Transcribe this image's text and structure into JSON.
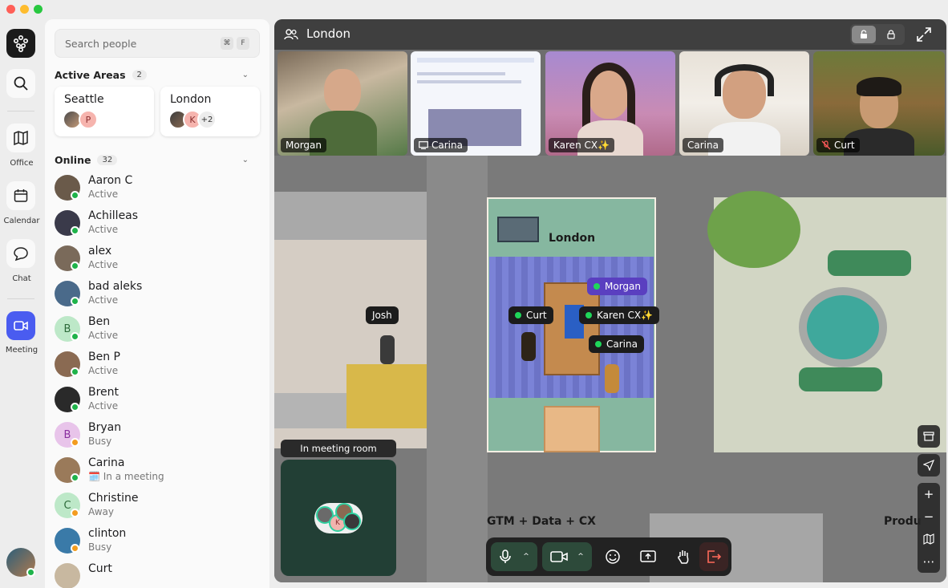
{
  "window": {
    "traffic_colors": [
      "#ff5f57",
      "#febc2e",
      "#28c840"
    ]
  },
  "rail": {
    "items": [
      {
        "label": "Office",
        "icon": "map-icon"
      },
      {
        "label": "Calendar",
        "icon": "calendar-icon"
      },
      {
        "label": "Chat",
        "icon": "chat-icon"
      },
      {
        "label": "Meeting",
        "icon": "video-icon"
      }
    ],
    "accent": "#4a5cf0"
  },
  "panel": {
    "search_placeholder": "Search people",
    "shortcut": [
      "⌘",
      "F"
    ],
    "active_areas": {
      "title": "Active Areas",
      "count": "2",
      "areas": [
        {
          "name": "Seattle",
          "avatar_letters": [
            "",
            "P"
          ]
        },
        {
          "name": "London",
          "avatar_letters": [
            "",
            "K",
            "+2"
          ]
        }
      ]
    },
    "online": {
      "title": "Online",
      "count": "32",
      "people": [
        {
          "name": "Aaron C",
          "status": "Active",
          "state": "active",
          "initial": ""
        },
        {
          "name": "Achilleas",
          "status": "Active",
          "state": "active",
          "initial": ""
        },
        {
          "name": "alex",
          "status": "Active",
          "state": "active",
          "initial": ""
        },
        {
          "name": "bad aleks",
          "status": "Active",
          "state": "active",
          "initial": ""
        },
        {
          "name": "Ben",
          "status": "Active",
          "state": "active",
          "initial": "B"
        },
        {
          "name": "Ben P",
          "status": "Active",
          "state": "active",
          "initial": ""
        },
        {
          "name": "Brent",
          "status": "Active",
          "state": "active",
          "initial": ""
        },
        {
          "name": "Bryan",
          "status": "Busy",
          "state": "busy",
          "initial": "B"
        },
        {
          "name": "Carina",
          "status": "🗓️ In a meeting",
          "state": "active",
          "initial": ""
        },
        {
          "name": "Christine",
          "status": "Away",
          "state": "away",
          "initial": "C"
        },
        {
          "name": "clinton",
          "status": "Busy",
          "state": "busy",
          "initial": ""
        },
        {
          "name": "Curt",
          "status": "",
          "state": "active",
          "initial": ""
        }
      ]
    }
  },
  "meeting": {
    "room_name": "London",
    "tiles": [
      {
        "name": "Morgan",
        "kind": "camera"
      },
      {
        "name": "Carina",
        "kind": "screen-share"
      },
      {
        "name": "Karen CX✨",
        "kind": "camera"
      },
      {
        "name": "Carina",
        "kind": "camera"
      },
      {
        "name": "Curt",
        "kind": "muted"
      }
    ]
  },
  "map": {
    "room_label": "London",
    "area_label": "GTM + Data + CX",
    "area_label_right": "Produ",
    "avatar_tags": [
      "Josh",
      "Morgan",
      "Curt",
      "Karen CX✨",
      "Carina"
    ],
    "mini_room_title": "In meeting room"
  },
  "controls": {
    "side": [
      "archive-icon",
      "locate-icon",
      "zoom-in-icon",
      "zoom-out-icon",
      "map-icon",
      "more-icon"
    ],
    "bottom": [
      "mic-icon",
      "camera-icon",
      "emoji-icon",
      "share-screen-icon",
      "raise-hand-icon",
      "leave-icon"
    ]
  }
}
